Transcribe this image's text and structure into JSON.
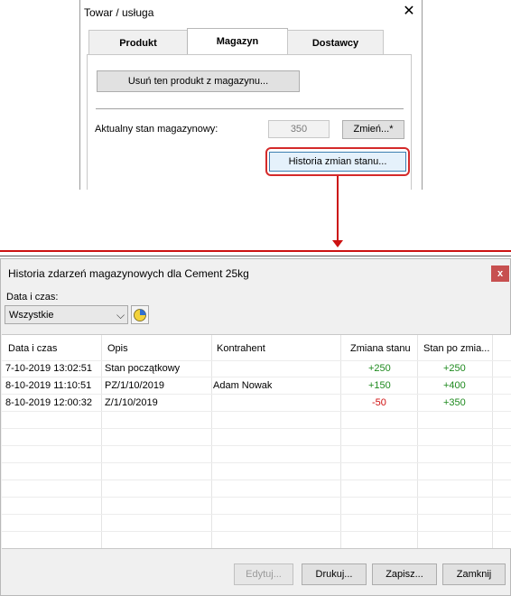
{
  "top_dialog": {
    "title": "Towar / usługa",
    "tabs": [
      "Produkt",
      "Magazyn",
      "Dostawcy"
    ],
    "active_tab": "Magazyn",
    "remove_button": "Usuń ten produkt z magazynu...",
    "stock_label": "Aktualny stan magazynowy:",
    "stock_value": "350",
    "change_button": "Zmień...*",
    "history_button": "Historia zmian stanu..."
  },
  "history_window": {
    "title": "Historia zdarzeń magazynowych dla Cement 25kg",
    "close_glyph": "x",
    "filter_label": "Data i czas:",
    "filter_value": "Wszystkie",
    "columns": [
      "Data i czas",
      "Opis",
      "Kontrahent",
      "Zmiana stanu",
      "Stan po zmia..."
    ],
    "rows": [
      {
        "date": "7-10-2019 13:02:51",
        "desc": "Stan początkowy",
        "contractor": "",
        "change": "+250",
        "after": "+250"
      },
      {
        "date": "8-10-2019 11:10:51",
        "desc": "PZ/1/10/2019",
        "contractor": "Adam Nowak",
        "change": "+150",
        "after": "+400"
      },
      {
        "date": "8-10-2019 12:00:32",
        "desc": "Z/1/10/2019",
        "contractor": "",
        "change": "-50",
        "after": "+350"
      }
    ],
    "buttons": {
      "edit": "Edytuj...",
      "print": "Drukuj...",
      "save": "Zapisz...",
      "close": "Zamknij"
    }
  },
  "colors": {
    "positive": "#1f8a1f",
    "negative": "#d01010",
    "highlight": "#d42a2a",
    "close_button": "#c75050"
  }
}
